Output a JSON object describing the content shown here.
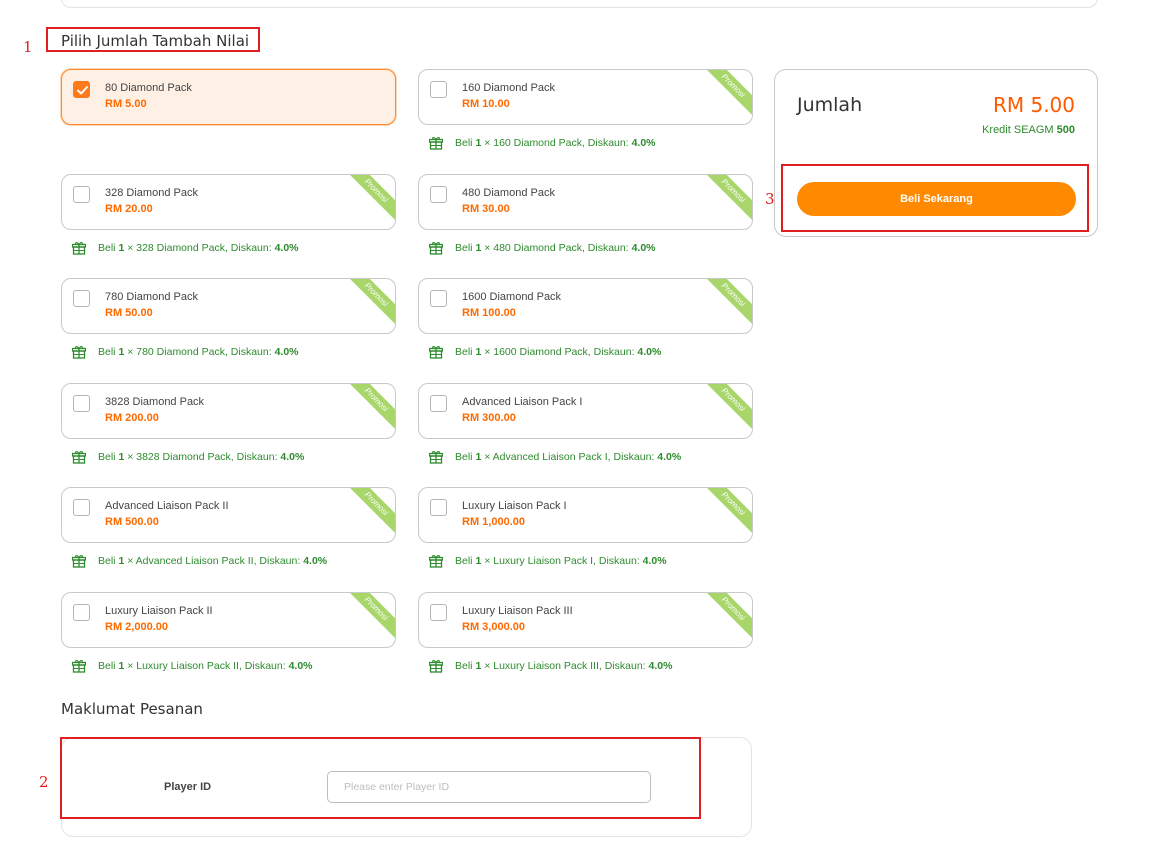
{
  "section_titles": {
    "amount": "Pilih Jumlah Tambah Nilai",
    "order_info": "Maklumat Pesanan"
  },
  "annotations": [
    "1",
    "2",
    "3"
  ],
  "promo_badge": "Promosi",
  "promo_template": {
    "prefix": "Beli ",
    "qty": "1",
    "times": " × ",
    "discount_label": ", Diskaun: ",
    "discount": "4.0%"
  },
  "packs": [
    {
      "name": "80 Diamond Pack",
      "price": "RM 5.00",
      "selected": true,
      "promo": false
    },
    {
      "name": "160 Diamond Pack",
      "price": "RM 10.00",
      "selected": false,
      "promo": true
    },
    {
      "name": "328 Diamond Pack",
      "price": "RM 20.00",
      "selected": false,
      "promo": true
    },
    {
      "name": "480 Diamond Pack",
      "price": "RM 30.00",
      "selected": false,
      "promo": true
    },
    {
      "name": "780 Diamond Pack",
      "price": "RM 50.00",
      "selected": false,
      "promo": true
    },
    {
      "name": "1600 Diamond Pack",
      "price": "RM 100.00",
      "selected": false,
      "promo": true
    },
    {
      "name": "3828 Diamond Pack",
      "price": "RM 200.00",
      "selected": false,
      "promo": true
    },
    {
      "name": "Advanced Liaison Pack I",
      "price": "RM 300.00",
      "selected": false,
      "promo": true
    },
    {
      "name": "Advanced Liaison Pack II",
      "price": "RM 500.00",
      "selected": false,
      "promo": true
    },
    {
      "name": "Luxury Liaison Pack I",
      "price": "RM 1,000.00",
      "selected": false,
      "promo": true
    },
    {
      "name": "Luxury Liaison Pack II",
      "price": "RM 2,000.00",
      "selected": false,
      "promo": true
    },
    {
      "name": "Luxury Liaison Pack III",
      "price": "RM 3,000.00",
      "selected": false,
      "promo": true
    }
  ],
  "summary": {
    "label": "Jumlah",
    "total": "RM 5.00",
    "credit_label": "Kredit SEAGM ",
    "credit_value": "500",
    "buy_button": "Beli Sekarang"
  },
  "order": {
    "player_id_label": "Player ID",
    "player_id_placeholder": "Please enter Player ID",
    "player_id_value": ""
  },
  "colors": {
    "accent": "#ff8a00",
    "price": "#ff6a00",
    "promo_text": "#2e8b2e",
    "ribbon": "#a8d66a",
    "annotation": "#e02020"
  }
}
